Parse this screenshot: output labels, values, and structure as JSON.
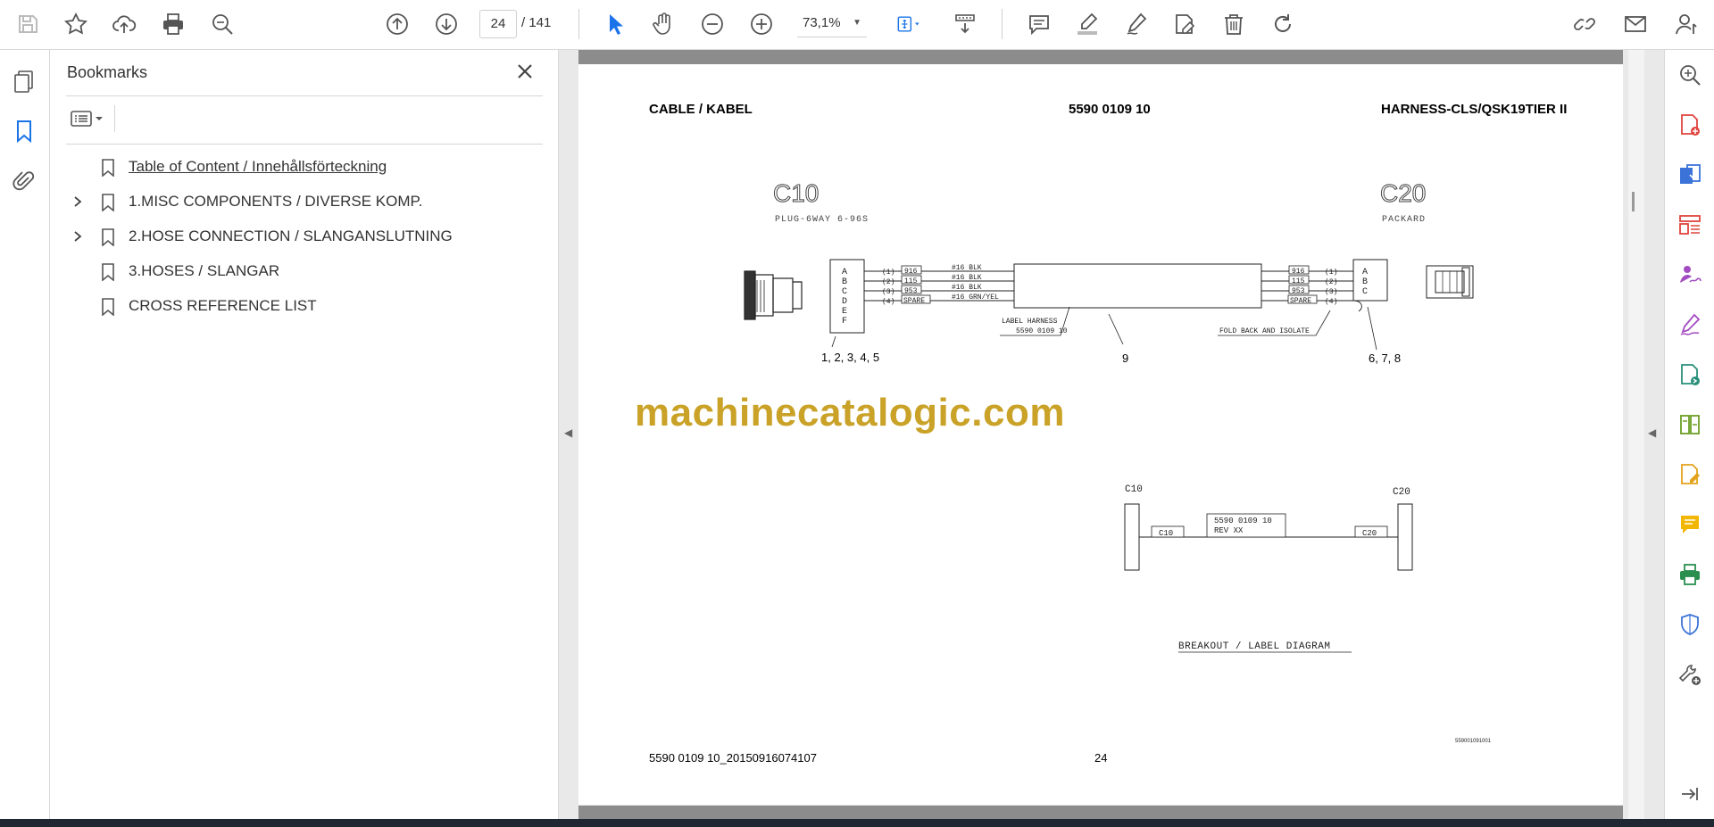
{
  "toolbar": {
    "page_current": "24",
    "page_total": "/ 141",
    "zoom": "73,1%"
  },
  "bookmarks": {
    "title": "Bookmarks",
    "items": [
      {
        "label": "Table of Content / Innehållsförteckning",
        "expandable": false
      },
      {
        "label": "1.MISC COMPONENTS / DIVERSE KOMP.",
        "expandable": true
      },
      {
        "label": "2.HOSE CONNECTION / SLANGANSLUTNING",
        "expandable": true
      },
      {
        "label": "3.HOSES / SLANGAR",
        "expandable": false
      },
      {
        "label": "CROSS REFERENCE LIST",
        "expandable": false
      }
    ]
  },
  "document": {
    "header_left": "CABLE / KABEL",
    "header_center": "5590 0109 10",
    "header_right": "HARNESS-CLS/QSK19TIER II",
    "connector_left_name": "C10",
    "connector_left_type": "PLUG-6WAY 6-96S",
    "connector_right_name": "C20",
    "connector_right_type": "PACKARD",
    "pins_left": [
      "A",
      "B",
      "C",
      "D",
      "E",
      "F"
    ],
    "pin_numbers": [
      "(1)",
      "(2)",
      "(3)",
      "(4)"
    ],
    "wires": [
      {
        "id": "916",
        "spec": "#16 BLK"
      },
      {
        "id": "115",
        "spec": "#16 BLK"
      },
      {
        "id": "953",
        "spec": "#16 BLK"
      },
      {
        "id": "SPARE",
        "spec": "#16 GRN/YEL"
      }
    ],
    "pins_right": [
      "A",
      "B",
      "C"
    ],
    "label_harness": "LABEL HARNESS",
    "label_harness_num": "5590 0109 10",
    "fold_back": "FOLD BACK AND ISOLATE",
    "callout_left": "1, 2, 3, 4, 5",
    "callout_center": "9",
    "callout_right": "6, 7, 8",
    "watermark": "machinecatalogic.com",
    "breakout_c10": "C10",
    "breakout_c20": "C20",
    "breakout_label_line1": "5590 0109 10",
    "breakout_label_line2": "REV XX",
    "breakout_title": "BREAKOUT / LABEL DIAGRAM",
    "drawing_code": "559001091001",
    "footer_left": "5590 0109 10_20150916074107",
    "footer_page": "24"
  }
}
